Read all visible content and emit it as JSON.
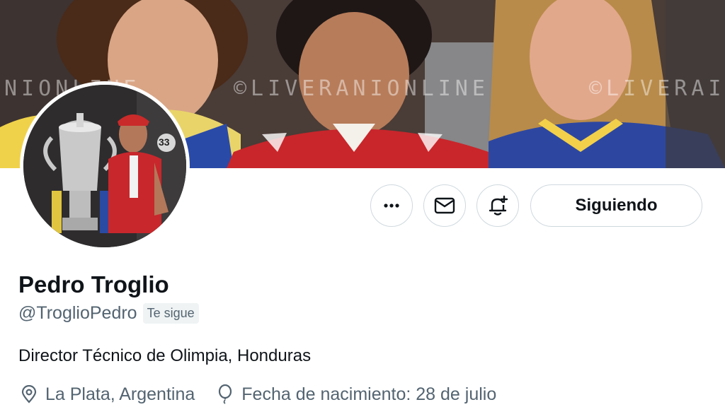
{
  "banner": {
    "watermark_texts": [
      "NIONLINE",
      "©LIVERANIONLINE",
      "©LIVERAI"
    ]
  },
  "profile": {
    "name": "Pedro Troglio",
    "handle": "@TroglioPedro",
    "follows_you_badge": "Te sigue",
    "bio": "Director Técnico de Olimpia, Honduras",
    "location": "La Plata, Argentina",
    "birthday": "Fecha de nacimiento: 28 de julio",
    "avatar_jersey_number": "33"
  },
  "actions": {
    "more_icon": "more-icon",
    "message_icon": "mail-icon",
    "notify_icon": "bell-plus-icon",
    "following_label": "Siguiendo"
  },
  "colors": {
    "text_primary": "#0f1419",
    "text_secondary": "#536471",
    "border": "#cfd9de",
    "badge_bg": "#eff3f4"
  }
}
